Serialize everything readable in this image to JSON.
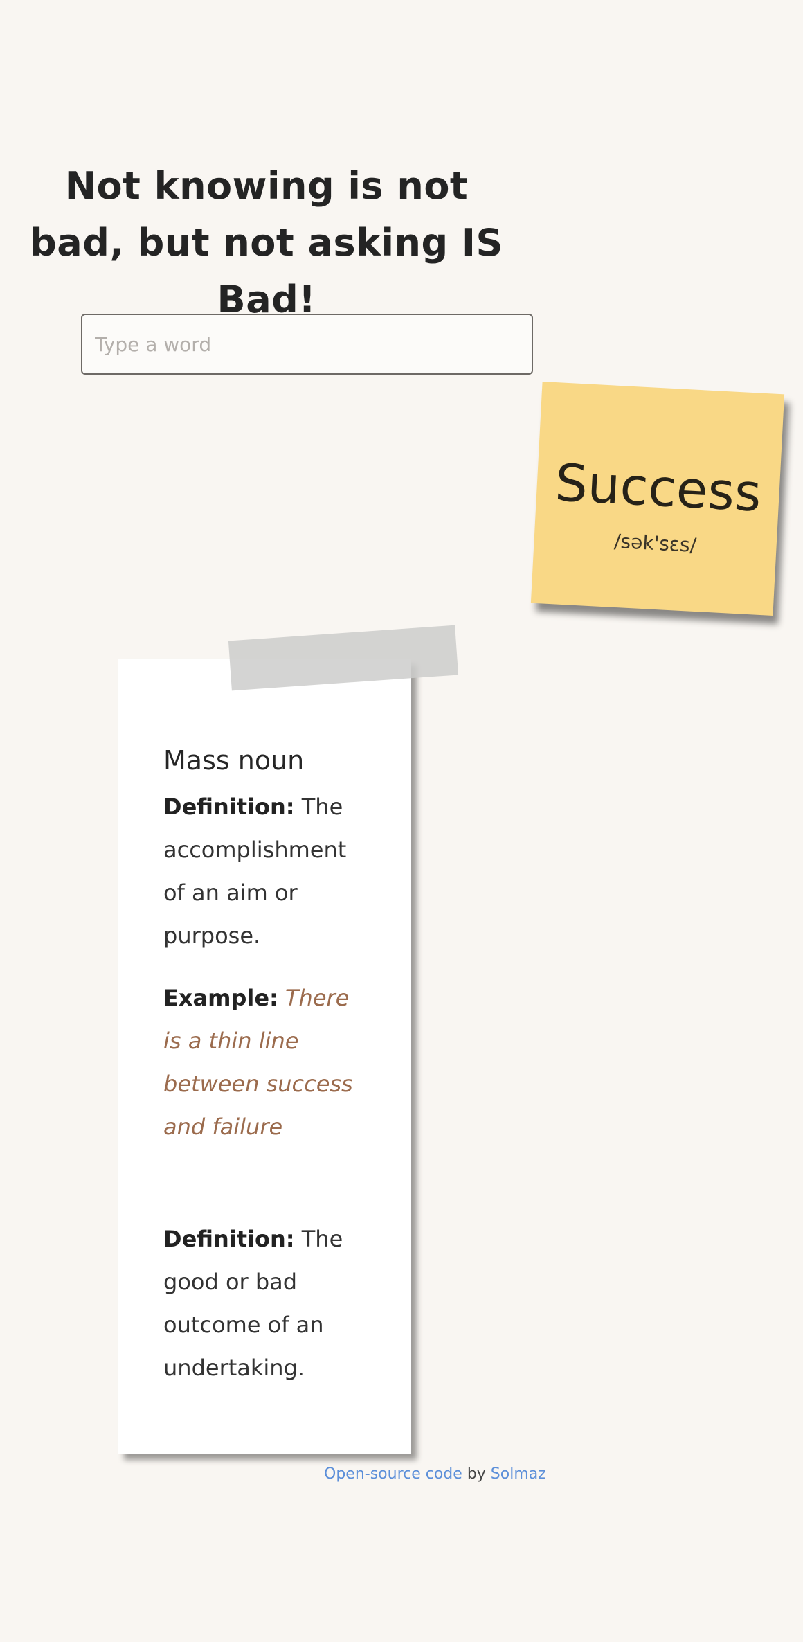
{
  "headline": {
    "text": "Not knowing is not bad, but not asking IS Bad!"
  },
  "search": {
    "placeholder": "Type a word",
    "value": ""
  },
  "sticky_note": {
    "word": "Success",
    "phonetic": "/sək'sɛs/"
  },
  "definition_card": {
    "part_of_speech": "Mass noun",
    "definition_label": "Definition:",
    "example_label": "Example:",
    "entries": [
      {
        "definition": "The accomplishment of an aim or purpose.",
        "example": "There is a thin line between success and failure"
      },
      {
        "definition": "The good or bad outcome of an undertaking."
      }
    ]
  },
  "footer": {
    "link_text": "Open-source code",
    "by_text": "by",
    "author_link": "Solmaz"
  },
  "colors": {
    "background": "#f9f6f2",
    "sticky_note": "#f9d886",
    "example_text": "#9b6b4d",
    "link": "#5c8fd9"
  }
}
